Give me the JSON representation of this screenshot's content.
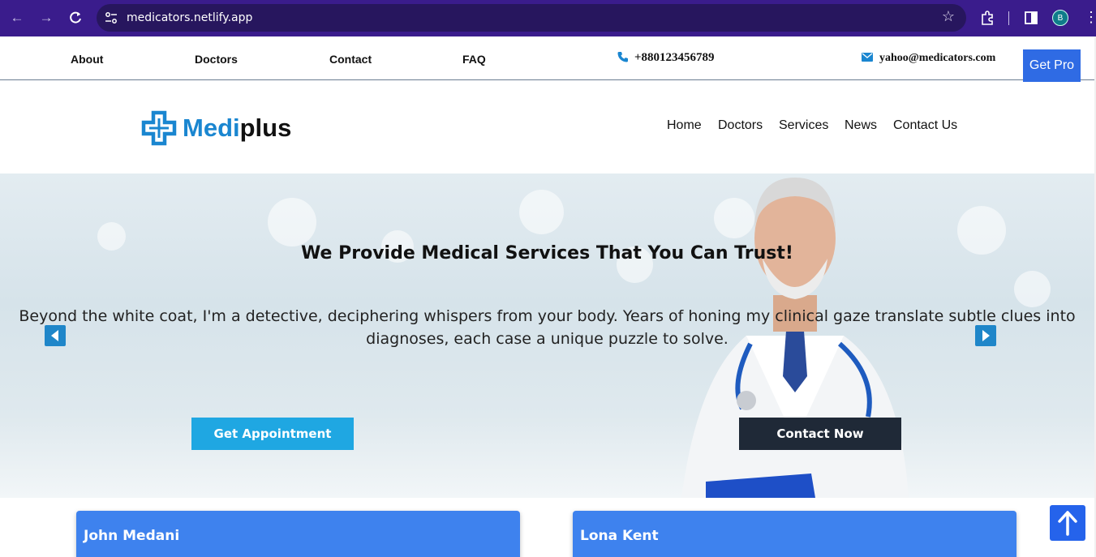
{
  "browser": {
    "url": "medicators.netlify.app",
    "profile_initial": "B",
    "icons": [
      "back-arrow-icon",
      "forward-arrow-icon",
      "reload-icon",
      "site-settings-icon",
      "bookmark-star-icon",
      "extensions-icon",
      "side-panel-icon",
      "menu-kebab-icon"
    ]
  },
  "topbar": {
    "links": [
      "About",
      "Doctors",
      "Contact",
      "FAQ"
    ],
    "phone": "+880123456789",
    "email": "yahoo@medicators.com",
    "get_pro": "Get Pro"
  },
  "header": {
    "brand_part1": "Medi",
    "brand_part2": "plus",
    "nav": [
      "Home",
      "Doctors",
      "Services",
      "News",
      "Contact Us"
    ]
  },
  "hero": {
    "title": "We Provide Medical Services That You Can Trust!",
    "text": "Beyond the white coat, I'm a detective, deciphering whispers from your body. Years of honing my clinical gaze translate subtle clues into diagnoses, each case a unique puzzle to solve.",
    "appointment_button": "Get Appointment",
    "contact_button": "Contact Now"
  },
  "doctors": [
    {
      "name": "John Medani"
    },
    {
      "name": "Lona Kent"
    }
  ],
  "colors": {
    "browser_bar": "#3a1c8c",
    "brand_blue": "#1a86d0",
    "get_pro": "#2f6be4",
    "appointment_btn": "#1fa7e2",
    "contact_btn": "#1f2937",
    "card_header": "#3e82ee"
  }
}
